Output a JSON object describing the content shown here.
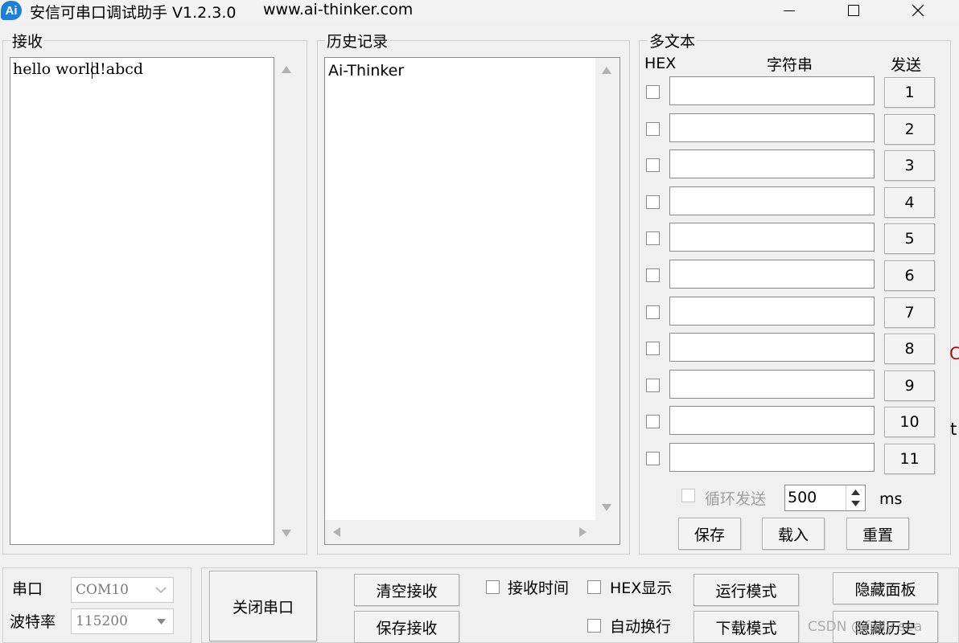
{
  "window": {
    "logo_text": "Ai",
    "title": "安信可串口调试助手 V1.2.3.0",
    "url": "www.ai-thinker.com"
  },
  "receive": {
    "label": "接收",
    "text": "hello world!abcd"
  },
  "history": {
    "label": "历史记录",
    "items": [
      "Ai-Thinker"
    ]
  },
  "multitext": {
    "label": "多文本",
    "col_hex": "HEX",
    "col_string": "字符串",
    "col_send": "发送",
    "rows": [
      {
        "hex": false,
        "value": "",
        "button": "1"
      },
      {
        "hex": false,
        "value": "",
        "button": "2"
      },
      {
        "hex": false,
        "value": "",
        "button": "3"
      },
      {
        "hex": false,
        "value": "",
        "button": "4"
      },
      {
        "hex": false,
        "value": "",
        "button": "5"
      },
      {
        "hex": false,
        "value": "",
        "button": "6"
      },
      {
        "hex": false,
        "value": "",
        "button": "7"
      },
      {
        "hex": false,
        "value": "",
        "button": "8"
      },
      {
        "hex": false,
        "value": "",
        "button": "9"
      },
      {
        "hex": false,
        "value": "",
        "button": "10"
      },
      {
        "hex": false,
        "value": "",
        "button": "11"
      }
    ],
    "loop_send_label": "循环发送",
    "interval_value": "500",
    "interval_unit": "ms",
    "save_label": "保存",
    "load_label": "载入",
    "reset_label": "重置"
  },
  "serial": {
    "port_label": "串口",
    "port_value": "COM10",
    "baud_label": "波特率",
    "baud_value": "115200"
  },
  "controls": {
    "close_port": "关闭串口",
    "clear_receive": "清空接收",
    "save_receive": "保存接收",
    "receive_time": "接收时间",
    "hex_display": "HEX显示",
    "auto_wrap": "自动换行",
    "run_mode": "运行模式",
    "download_mode": "下载模式",
    "hide_panel": "隐藏面板",
    "hide_history": "隐藏历史"
  },
  "edge_fragments": [
    "C",
    "t"
  ],
  "watermark": "CSDN @fully sea"
}
